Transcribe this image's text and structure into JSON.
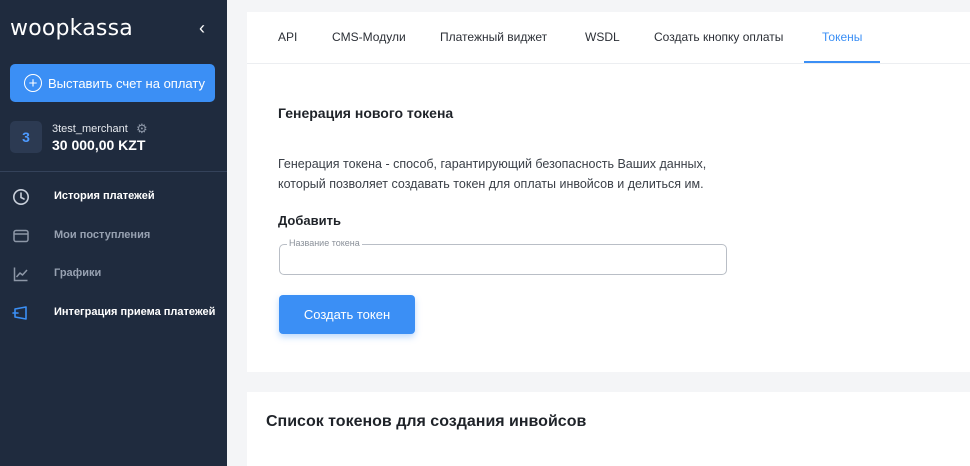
{
  "sidebar": {
    "logo": "woopkassa",
    "collapse_glyph": "‹",
    "invoice_button": "Выставить счет на оплату",
    "merchant": {
      "avatar_letter": "3",
      "name": "3test_merchant",
      "balance": "30 000,00 KZT"
    },
    "nav": [
      {
        "label": "История платежей",
        "icon": "clock-icon"
      },
      {
        "label": "Мои поступления",
        "icon": "wallet-icon"
      },
      {
        "label": "Графики",
        "icon": "chart-icon"
      },
      {
        "label": "Интеграция приема платежей",
        "icon": "integration-icon"
      }
    ]
  },
  "tabs": [
    {
      "label": "API"
    },
    {
      "label": "CMS-Модули"
    },
    {
      "label": "Платежный виджет"
    },
    {
      "label": "WSDL"
    },
    {
      "label": "Создать кнопку оплаты"
    },
    {
      "label": "Токены",
      "active": true
    }
  ],
  "generation": {
    "title": "Генерация нового токена",
    "description_line1": "Генерация токена - способ, гарантирующий безопасность Ваших данных,",
    "description_line2": "который позволяет создавать токен для оплаты инвойсов и делиться им.",
    "add_label": "Добавить",
    "field_label": "Название токена",
    "field_value": "",
    "create_button": "Создать токен"
  },
  "tokens_list": {
    "title": "Список токенов для создания инвойсов"
  },
  "colors": {
    "sidebar_bg": "#1f2b3e",
    "accent": "#3b8ff5",
    "page_bg": "#f4f5f7"
  }
}
